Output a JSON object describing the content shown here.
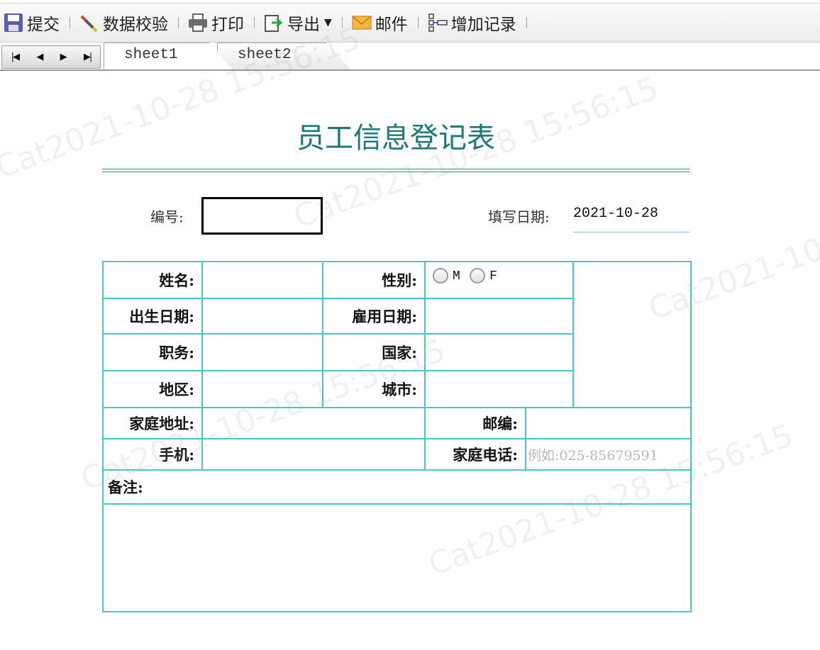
{
  "toolbar": {
    "submit": "提交",
    "validate": "数据校验",
    "print": "打印",
    "export": "导出",
    "mail": "邮件",
    "add_record": "增加记录"
  },
  "sheets": [
    "sheet1",
    "sheet2"
  ],
  "watermark": "Cat2021-10-28 15:56:15",
  "form": {
    "title": "员工信息登记表",
    "serial_label": "编号:",
    "serial_value": "",
    "date_label": "填写日期:",
    "date_value": "2021-10-28",
    "labels": {
      "name": "姓名:",
      "gender": "性别:",
      "birth": "出生日期:",
      "hire": "雇用日期:",
      "position": "职务:",
      "country": "国家:",
      "region": "地区:",
      "city": "城市:",
      "address": "家庭地址:",
      "zip": "邮编:",
      "mobile": "手机:",
      "home_phone": "家庭电话:",
      "remark": "备注:"
    },
    "gender_options": [
      "M",
      "F"
    ],
    "home_phone_placeholder": "例如:025-85679591"
  },
  "colors": {
    "title": "#1a7a7a",
    "table_border": "#46c8c8"
  }
}
